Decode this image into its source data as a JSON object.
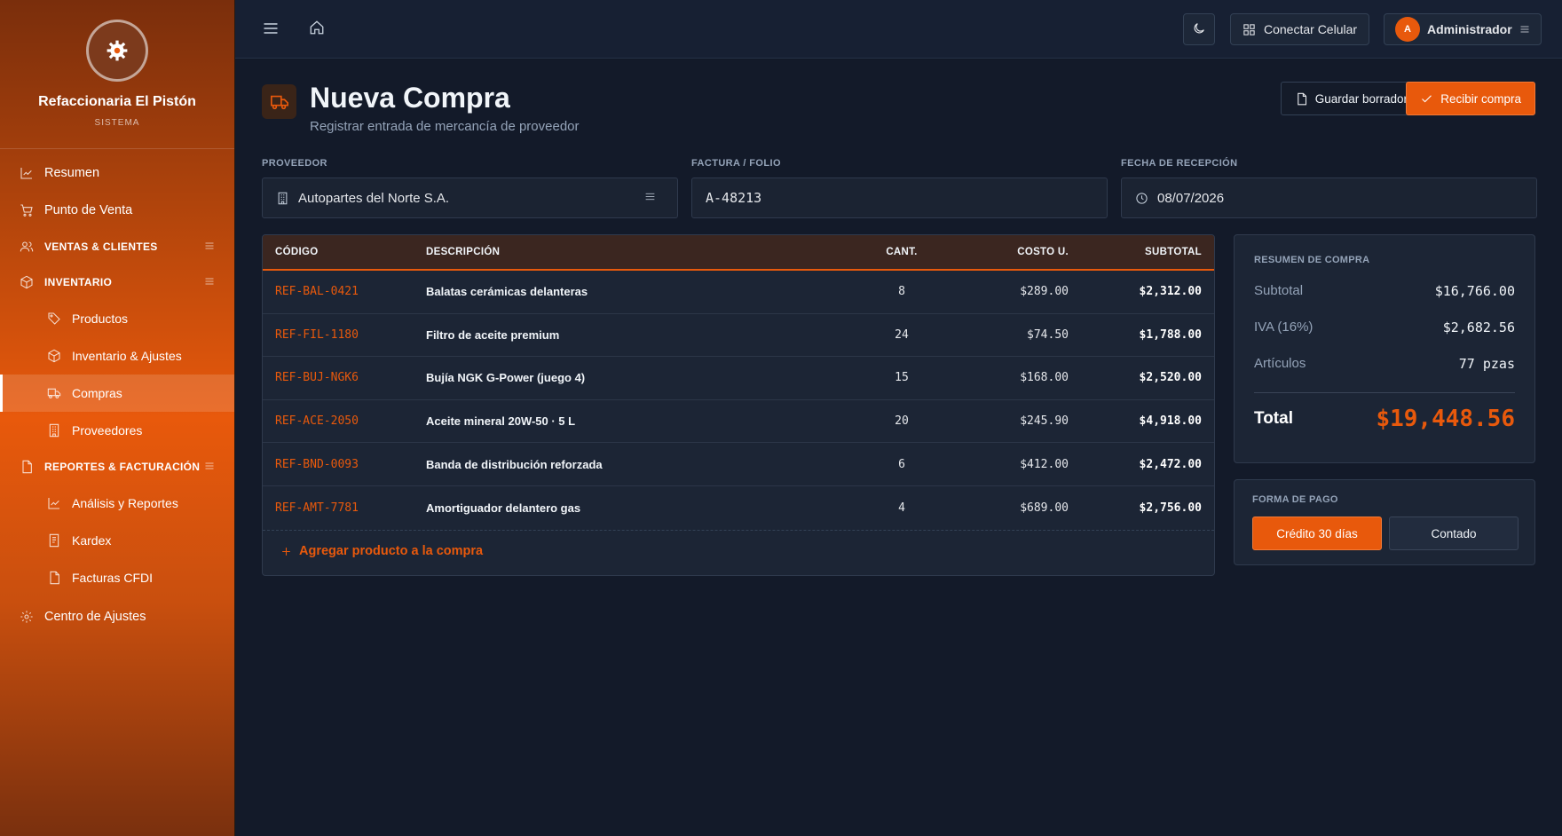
{
  "brand": {
    "name": "Refaccionaria El Pistón",
    "subtitle": "SISTEMA"
  },
  "nav": {
    "resumen": "Resumen",
    "pos": "Punto de Venta",
    "ventas_section": "VENTAS & CLIENTES",
    "inventario_section": "INVENTARIO",
    "productos": "Productos",
    "inventario_ajustes": "Inventario & Ajustes",
    "compras": "Compras",
    "proveedores": "Proveedores",
    "reportes_section": "REPORTES & FACTURACIÓN",
    "analisis": "Análisis y Reportes",
    "kardex": "Kardex",
    "facturas": "Facturas CFDI",
    "ajustes": "Centro de Ajustes"
  },
  "topbar": {
    "connect_label": "Conectar Celular",
    "user_initial": "A",
    "user_name": "Administrador"
  },
  "page": {
    "title": "Nueva Compra",
    "subtitle": "Registrar entrada de mercancía de proveedor",
    "draft_label": "Guardar borrador",
    "receive_label": "Recibir compra"
  },
  "form": {
    "supplier_label": "PROVEEDOR",
    "supplier_value": "Autopartes del Norte S.A.",
    "invoice_label": "FACTURA / FOLIO",
    "invoice_value": "A-48213",
    "date_label": "FECHA DE RECEPCIÓN",
    "date_value": "08/07/2026"
  },
  "table": {
    "headers": {
      "code": "CÓDIGO",
      "desc": "DESCRIPCIÓN",
      "qty": "CANT.",
      "cost": "COSTO U.",
      "subtotal": "SUBTOTAL"
    },
    "rows": [
      {
        "code": "REF-BAL-0421",
        "desc": "Balatas cerámicas delanteras",
        "qty": "8",
        "cost": "$289.00",
        "subtotal": "$2,312.00"
      },
      {
        "code": "REF-FIL-1180",
        "desc": "Filtro de aceite premium",
        "qty": "24",
        "cost": "$74.50",
        "subtotal": "$1,788.00"
      },
      {
        "code": "REF-BUJ-NGK6",
        "desc": "Bujía NGK G-Power (juego 4)",
        "qty": "15",
        "cost": "$168.00",
        "subtotal": "$2,520.00"
      },
      {
        "code": "REF-ACE-2050",
        "desc": "Aceite mineral 20W-50 · 5 L",
        "qty": "20",
        "cost": "$245.90",
        "subtotal": "$4,918.00"
      },
      {
        "code": "REF-BND-0093",
        "desc": "Banda de distribución reforzada",
        "qty": "6",
        "cost": "$412.00",
        "subtotal": "$2,472.00"
      },
      {
        "code": "REF-AMT-7781",
        "desc": "Amortiguador delantero gas",
        "qty": "4",
        "cost": "$689.00",
        "subtotal": "$2,756.00"
      }
    ],
    "add_label": "Agregar producto a la compra"
  },
  "summary": {
    "title": "RESUMEN DE COMPRA",
    "subtotal_label": "Subtotal",
    "subtotal_value": "$16,766.00",
    "iva_label": "IVA (16%)",
    "iva_value": "$2,682.56",
    "items_label": "Artículos",
    "items_value": "77 pzas",
    "total_label": "Total",
    "total_value": "$19,448.56"
  },
  "payment": {
    "title": "FORMA DE PAGO",
    "credit_label": "Crédito 30 días",
    "cash_label": "Contado"
  },
  "colors": {
    "accent": "#e8590c",
    "background": "#131a29",
    "card": "#1c2535"
  }
}
